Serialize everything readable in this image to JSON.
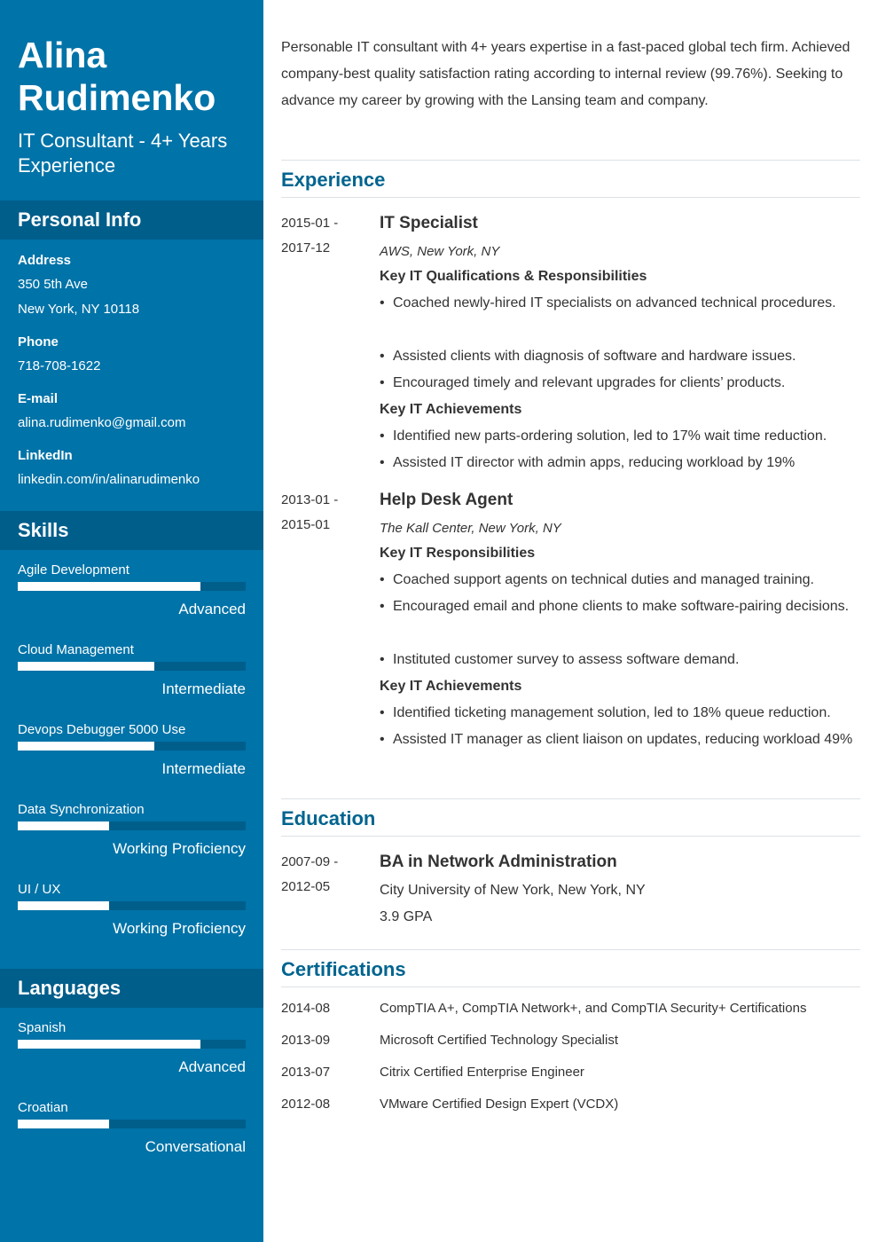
{
  "profile": {
    "name_line1": "Alina",
    "name_line2": "Rudimenko",
    "subtitle": "IT Consultant - 4+ Years Experience"
  },
  "personal_info": {
    "heading": "Personal Info",
    "address_label": "Address",
    "address_line1": "350 5th Ave",
    "address_line2": "New York, NY 10118",
    "phone_label": "Phone",
    "phone": "718-708-1622",
    "email_label": "E-mail",
    "email": "alina.rudimenko@gmail.com",
    "linkedin_label": "LinkedIn",
    "linkedin": "linkedin.com/in/alinarudimenko"
  },
  "skills": {
    "heading": "Skills",
    "items": [
      {
        "name": "Agile Development",
        "level": "Advanced",
        "fill": 0.8
      },
      {
        "name": "Cloud Management",
        "level": "Intermediate",
        "fill": 0.6
      },
      {
        "name": "Devops Debugger 5000 Use",
        "level": "Intermediate",
        "fill": 0.6
      },
      {
        "name": "Data Synchronization",
        "level": "Working Proficiency",
        "fill": 0.4
      },
      {
        "name": "UI / UX",
        "level": "Working Proficiency",
        "fill": 0.4
      }
    ]
  },
  "languages": {
    "heading": "Languages",
    "items": [
      {
        "name": "Spanish",
        "level": "Advanced",
        "fill": 0.8
      },
      {
        "name": "Croatian",
        "level": "Conversational",
        "fill": 0.4
      }
    ]
  },
  "summary": "Personable IT consultant with 4+ years expertise in a fast-paced global tech firm. Achieved company-best quality satisfaction rating according to internal review (99.76%). Seeking to advance my career by growing with the Lansing team and company.",
  "experience": {
    "heading": "Experience",
    "jobs": [
      {
        "date_start": "2015-01 -",
        "date_end": "2017-12",
        "title": "IT Specialist",
        "company": "AWS, New York, NY",
        "resp_heading": "Key IT Qualifications & Responsibilities",
        "resp": [
          "Coached newly-hired IT specialists on advanced technical procedures.",
          "Assisted clients with diagnosis of software and hardware issues.",
          "Encouraged timely and relevant upgrades for clients’ products."
        ],
        "ach_heading": "Key IT Achievements",
        "ach": [
          "Identified new parts-ordering solution, led to 17% wait time reduction.",
          "Assisted IT director with admin apps, reducing workload by 19%"
        ]
      },
      {
        "date_start": "2013-01 -",
        "date_end": "2015-01",
        "title": "Help Desk Agent",
        "company": "The Kall Center, New York, NY",
        "resp_heading": "Key IT Responsibilities",
        "resp": [
          "Coached support agents on technical duties and managed training.",
          "Encouraged email and phone clients to make software-pairing decisions.",
          "Instituted customer survey to assess software demand."
        ],
        "ach_heading": "Key IT Achievements",
        "ach": [
          "Identified ticketing management solution, led to 18% queue reduction.",
          "Assisted IT manager as client liaison on updates, reducing workload 49%"
        ]
      }
    ]
  },
  "education": {
    "heading": "Education",
    "date_start": "2007-09 -",
    "date_end": "2012-05",
    "degree": "BA in Network Administration",
    "school": "City University of New York, New York, NY",
    "gpa": "3.9 GPA"
  },
  "certifications": {
    "heading": "Certifications",
    "items": [
      {
        "date": "2014-08",
        "name": "CompTIA A+, CompTIA Network+, and CompTIA Security+ Certifications"
      },
      {
        "date": "2013-09",
        "name": "Microsoft Certified Technology Specialist"
      },
      {
        "date": "2013-07",
        "name": "Citrix Certified Enterprise Engineer"
      },
      {
        "date": "2012-08",
        "name": "VMware Certified Design Expert (VCDX)"
      }
    ]
  }
}
